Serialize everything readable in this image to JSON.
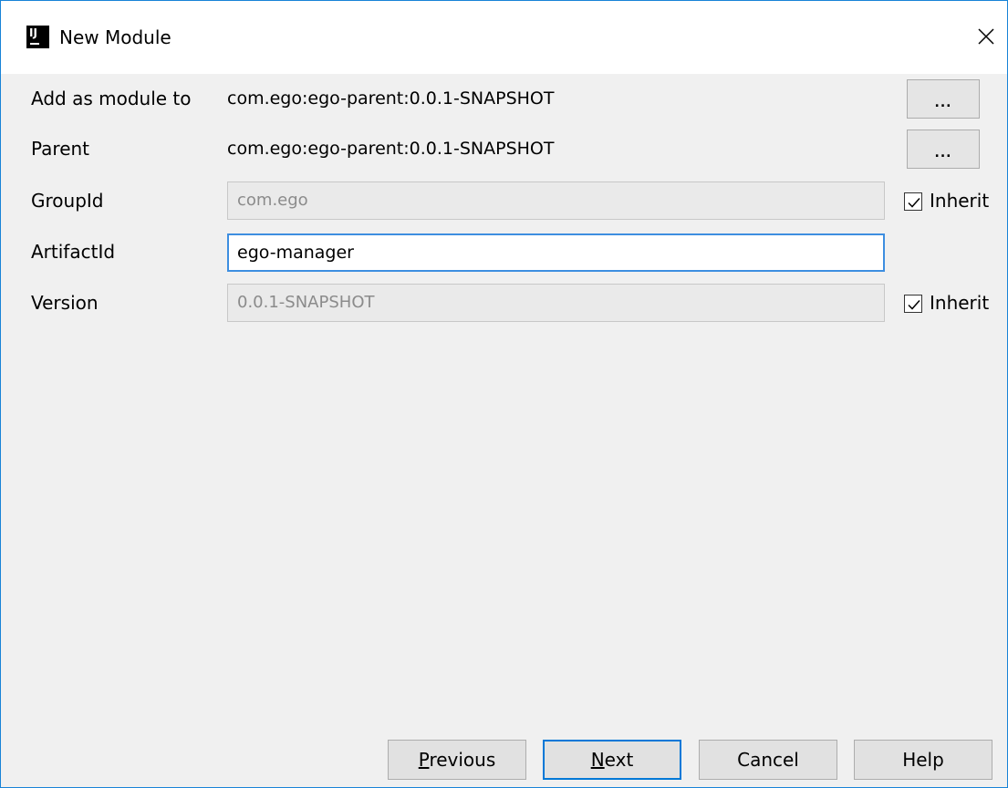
{
  "window": {
    "title": "New Module",
    "app_icon_text": "IJ"
  },
  "form": {
    "add_as_module_to": {
      "label": "Add as module to",
      "value": "com.ego:ego-parent:0.0.1-SNAPSHOT",
      "browse_label": "..."
    },
    "parent": {
      "label": "Parent",
      "value": "com.ego:ego-parent:0.0.1-SNAPSHOT",
      "browse_label": "..."
    },
    "group_id": {
      "label": "GroupId",
      "value": "com.ego",
      "inherit_label": "Inherit",
      "inherit_checked": true
    },
    "artifact_id": {
      "label": "ArtifactId",
      "value": "ego-manager"
    },
    "version": {
      "label": "Version",
      "value": "0.0.1-SNAPSHOT",
      "inherit_label": "Inherit",
      "inherit_checked": true
    }
  },
  "buttons": {
    "previous": {
      "mnemonic": "P",
      "rest": "revious"
    },
    "next": {
      "mnemonic": "N",
      "rest": "ext"
    },
    "cancel": "Cancel",
    "help": "Help"
  },
  "colors": {
    "window_border": "#1883d7",
    "focus_border": "#3d8ee0",
    "default_button_border": "#0078d7"
  }
}
